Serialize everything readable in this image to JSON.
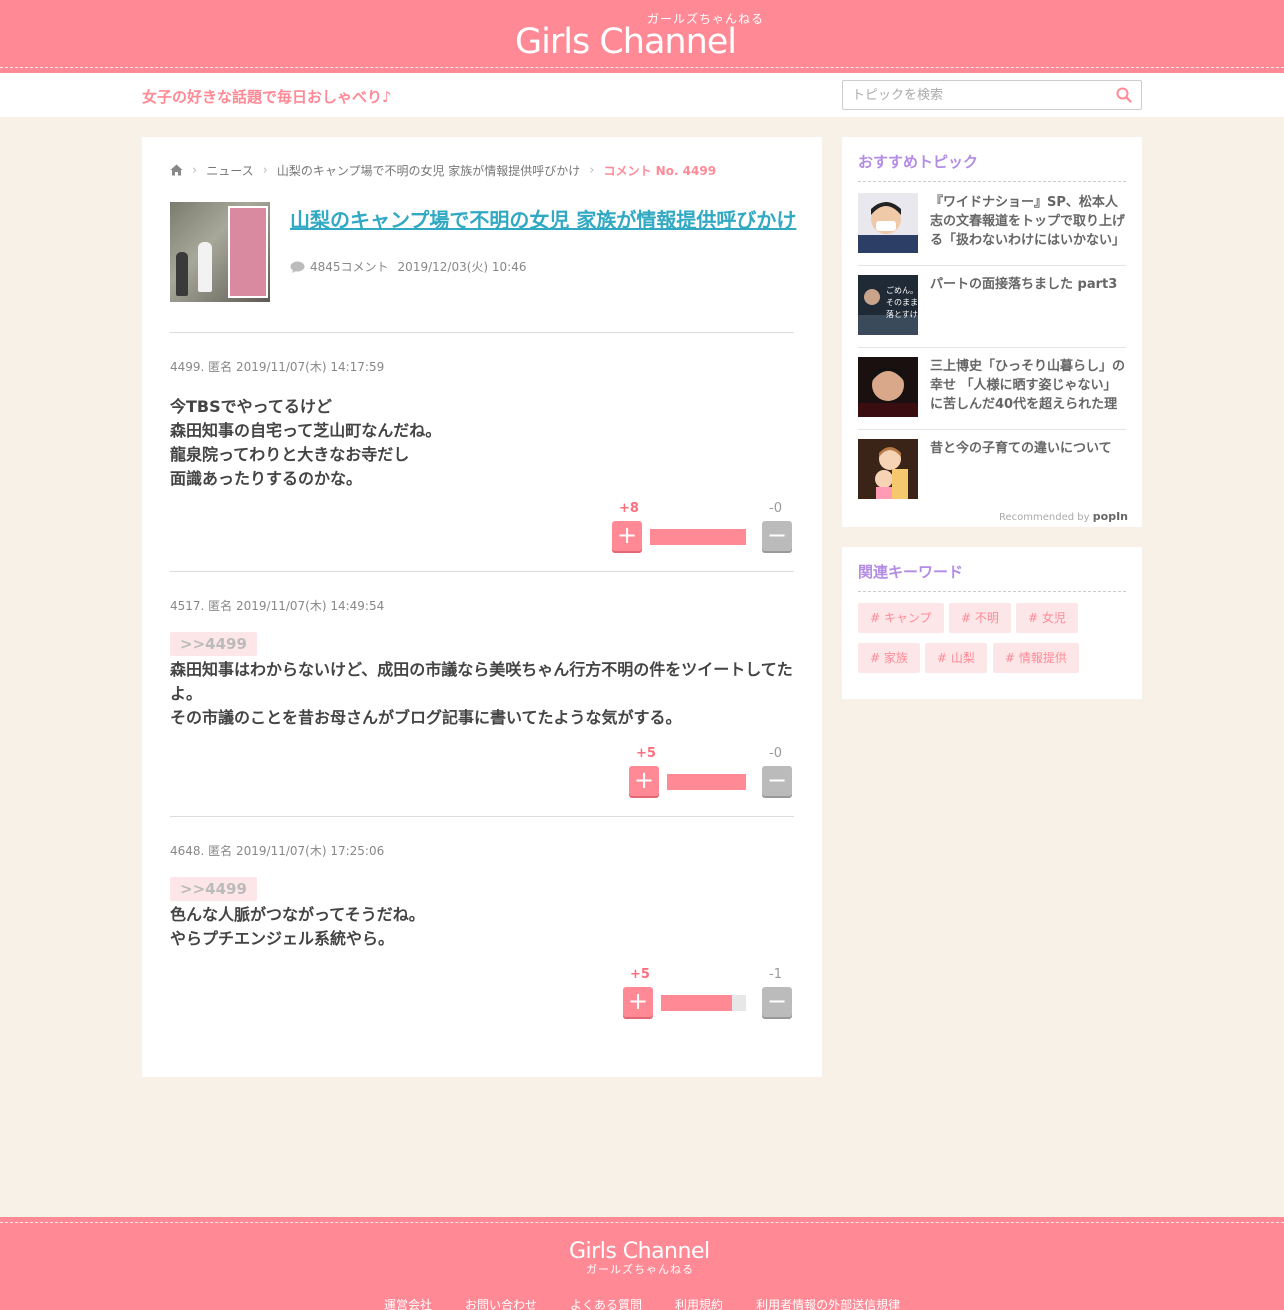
{
  "header": {
    "logo": "Girls Channel",
    "logo_sub": "ガールズちゃんねる",
    "tagline": "女子の好きな話題で毎日おしゃべり♪",
    "search_placeholder": "トピックを検索"
  },
  "breadcrumb": {
    "items": [
      "ニュース",
      "山梨のキャンプ場で不明の女児 家族が情報提供呼びかけ"
    ],
    "current": "コメント No. 4499"
  },
  "topic": {
    "title": "山梨のキャンプ場で不明の女児 家族が情報提供呼びかけ",
    "comment_count": "4845コメント",
    "date": "2019/12/03(火) 10:46"
  },
  "comments": [
    {
      "header": "4499. 匿名 2019/11/07(木) 14:17:59",
      "reply": "",
      "lines": [
        "今TBSでやってるけど",
        "森田知事の自宅って芝山町なんだね。",
        "龍泉院ってわりと大きなお寺だし",
        "面識あったりするのかな。"
      ],
      "plus": "+8",
      "minus": "-0",
      "plus_ratio": 1.0
    },
    {
      "header": "4517. 匿名 2019/11/07(木) 14:49:54",
      "reply": ">>4499",
      "lines": [
        "森田知事はわからないけど、成田の市議なら美咲ちゃん行方不明の件をツイートしてたよ。",
        "その市議のことを昔お母さんがブログ記事に書いてたような気がする。"
      ],
      "plus": "+5",
      "minus": "-0",
      "plus_ratio": 1.0
    },
    {
      "header": "4648. 匿名 2019/11/07(木) 17:25:06",
      "reply": ">>4499",
      "lines": [
        "色んな人脈がつながってそうだね。",
        "やらプチエンジェル系統やら。"
      ],
      "plus": "+5",
      "minus": "-1",
      "plus_ratio": 0.83
    }
  ],
  "sidebar": {
    "recommend_title": "おすすめトピック",
    "recommend": [
      {
        "text": "『ワイドナショー』SP、松本人志の文春報道をトップで取り上げる「扱わないわけにはいかない」",
        "thumb_icon": "person-mask-photo"
      },
      {
        "text": "パートの面接落ちました part3",
        "thumb_icon": "tv-caption-photo"
      },
      {
        "text": "三上博史「ひっそり山暮らし」の幸せ 「人様に晒す姿じゃない」に苦しんだ40代を超えられた理由",
        "thumb_icon": "portrait-photo"
      },
      {
        "text": "昔と今の子育ての違いについて",
        "thumb_icon": "family-illustration"
      }
    ],
    "recommended_by": "Recommended by",
    "popin": "popIn",
    "keywords_title": "関連キーワード",
    "keywords": [
      "# キャンプ",
      "# 不明",
      "# 女児",
      "# 家族",
      "# 山梨",
      "# 情報提供"
    ]
  },
  "footer": {
    "logo": "Girls Channel",
    "logo_sub": "ガールズちゃんねる",
    "links": [
      "運営会社",
      "お問い合わせ",
      "よくある質問",
      "利用規約",
      "利用者情報の外部送信規律"
    ]
  },
  "colors": {
    "brand_pink": "#ff8a96",
    "link_blue": "#31a9c3",
    "sidebar_purple": "#b38de3",
    "background": "#f8f1e8"
  }
}
